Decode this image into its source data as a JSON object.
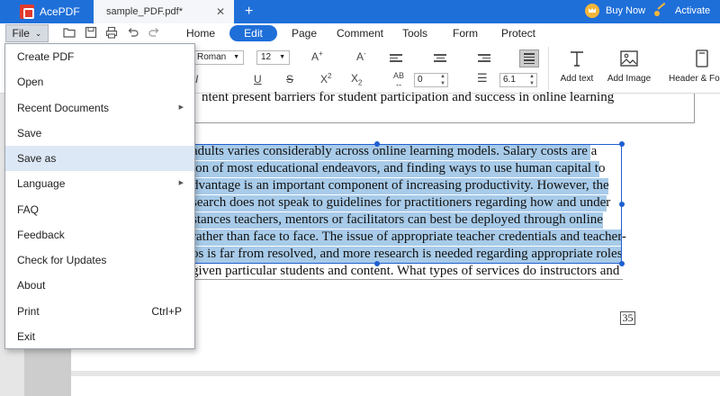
{
  "titlebar": {
    "app_name": "AcePDF",
    "doc_tab": "sample_PDF.pdf*",
    "close_glyph": "✕",
    "new_tab_glyph": "+",
    "buy_now": "Buy Now",
    "activate": "Activate",
    "color": "#1f6fd9"
  },
  "menubar": {
    "file_label": "File",
    "tabs": [
      "Home",
      "Edit",
      "Page",
      "Comment",
      "Tools",
      "Form",
      "Protect"
    ],
    "active_tab": "Edit"
  },
  "ribbon": {
    "font_name": "Roman",
    "font_size": "12",
    "char_spacing": "0",
    "line_spacing": "6.1",
    "tools": [
      "Add text",
      "Add Image",
      "Header & Fo"
    ]
  },
  "document": {
    "top_line": "ntent present barriers for student participation and success in online learning",
    "lines": [
      "adults varies considerably across online learning models. Salary costs are a",
      "ion of most educational endeavors, and finding ways to use human capital to",
      "dvantage is an important component of increasing productivity. However, the",
      "search does not speak to guidelines for practitioners regarding how and under",
      "stances teachers, mentors or facilitators can best be deployed through online",
      " rather than face to face. The issue of appropriate teacher credentials and teacher-",
      "os is far from resolved, and more research is needed regarding appropriate roles",
      "given particular students and content. What types of services do instructors and"
    ],
    "page_number": "35"
  },
  "file_menu": {
    "items": [
      {
        "label": "Create PDF"
      },
      {
        "label": "Open"
      },
      {
        "label": "Recent Documents",
        "submenu": true
      },
      {
        "label": "Save"
      },
      {
        "label": "Save as",
        "highlighted": true
      },
      {
        "label": "Language",
        "submenu": true
      },
      {
        "label": "FAQ"
      },
      {
        "label": "Feedback"
      },
      {
        "label": "Check for Updates"
      },
      {
        "label": "About"
      },
      {
        "label": "Print",
        "shortcut": "Ctrl+P"
      },
      {
        "label": "Exit"
      }
    ]
  }
}
